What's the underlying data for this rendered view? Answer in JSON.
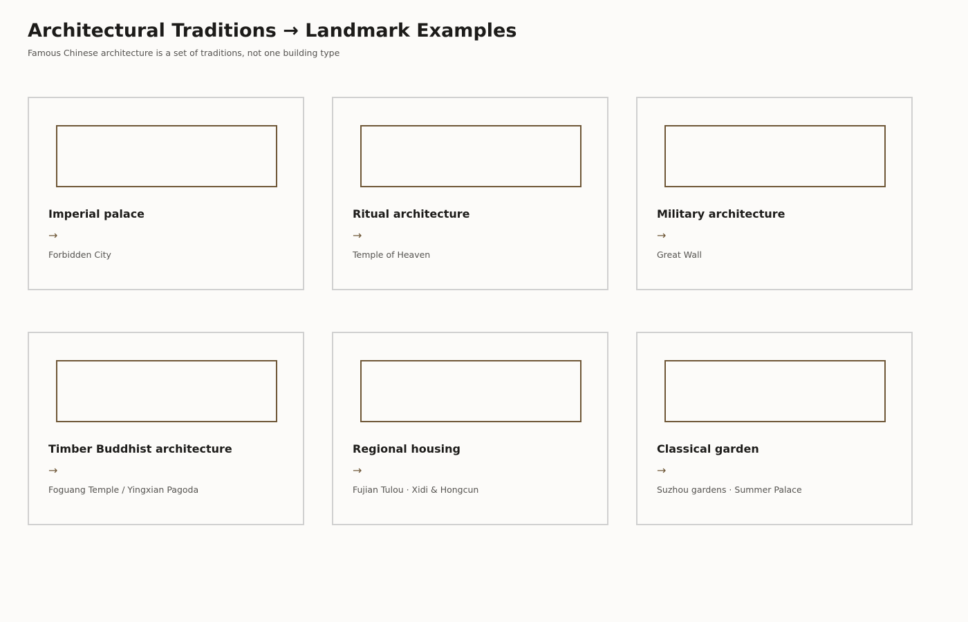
{
  "header": {
    "title": "Architectural Traditions → Landmark Examples",
    "subtitle": "Famous Chinese architecture is a set of traditions, not one building type"
  },
  "connector_symbol": "→",
  "colors": {
    "accent": "#6e5636",
    "card_border": "#d0d0d0",
    "background": "#fcfbf9",
    "title_text": "#1c1b19",
    "muted_text": "#555350"
  },
  "cards": [
    {
      "tradition": "Imperial palace",
      "landmark": "Forbidden City"
    },
    {
      "tradition": "Ritual architecture",
      "landmark": "Temple of Heaven"
    },
    {
      "tradition": "Military architecture",
      "landmark": "Great Wall"
    },
    {
      "tradition": "Timber Buddhist architecture",
      "landmark": "Foguang Temple / Yingxian Pagoda"
    },
    {
      "tradition": "Regional housing",
      "landmark": "Fujian Tulou · Xidi & Hongcun"
    },
    {
      "tradition": "Classical garden",
      "landmark": "Suzhou gardens · Summer Palace"
    }
  ]
}
